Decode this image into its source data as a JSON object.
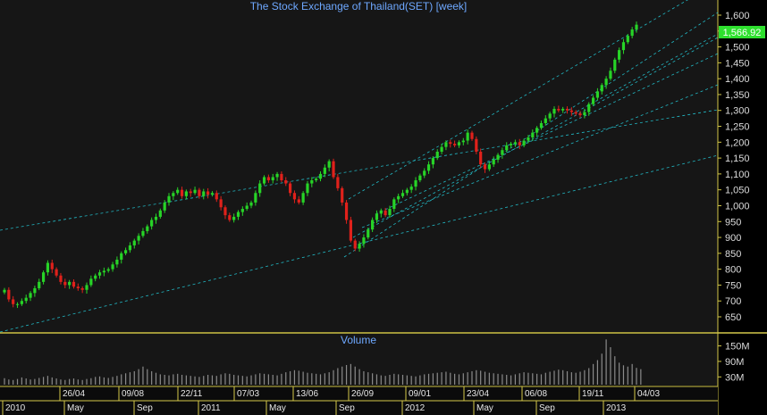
{
  "chart_data": {
    "type": "candlestick",
    "title": "The Stock Exchange of Thailand(SET) [week]",
    "volume_title": "Volume",
    "price_ylim": [
      625,
      1625
    ],
    "price_ticks": [
      "1,600",
      "1,550",
      "1,500",
      "1,450",
      "1,400",
      "1,350",
      "1,300",
      "1,250",
      "1,200",
      "1,150",
      "1,100",
      "1,050",
      "1,000",
      "950",
      "900",
      "850",
      "800",
      "750",
      "700",
      "650"
    ],
    "last_price_label": "1,566.92",
    "volume_ylim": [
      0,
      190
    ],
    "volume_ticks": [
      "150M",
      "90M",
      "30M"
    ],
    "x_week_labels": [
      "26/04",
      "09/08",
      "22/11",
      "07/03",
      "13/06",
      "26/09",
      "09/01",
      "23/04",
      "06/08",
      "19/11",
      "04/03"
    ],
    "x_month_labels": [
      "2010",
      "May",
      "Sep",
      "2011",
      "May",
      "Sep",
      "2012",
      "May",
      "Sep",
      "2013"
    ],
    "up_color": "#27d427",
    "down_color": "#e0211b",
    "trendline_color": "#22b8c4",
    "grid": false,
    "closes": [
      735,
      705,
      690,
      690,
      700,
      710,
      725,
      740,
      760,
      790,
      820,
      800,
      780,
      760,
      750,
      760,
      745,
      740,
      735,
      750,
      770,
      780,
      790,
      795,
      800,
      815,
      830,
      850,
      860,
      875,
      890,
      905,
      920,
      935,
      955,
      965,
      985,
      1010,
      1030,
      1040,
      1050,
      1030,
      1045,
      1040,
      1050,
      1030,
      1045,
      1035,
      1040,
      1020,
      995,
      970,
      955,
      965,
      980,
      990,
      1000,
      1010,
      1040,
      1070,
      1090,
      1080,
      1090,
      1100,
      1080,
      1070,
      1040,
      1020,
      1010,
      1040,
      1070,
      1080,
      1085,
      1100,
      1120,
      1140,
      1090,
      1055,
      1010,
      955,
      890,
      865,
      880,
      900,
      925,
      955,
      975,
      985,
      970,
      990,
      1020,
      1030,
      1040,
      1050,
      1060,
      1080,
      1095,
      1110,
      1130,
      1150,
      1170,
      1185,
      1200,
      1195,
      1190,
      1200,
      1205,
      1230,
      1210,
      1170,
      1130,
      1115,
      1130,
      1145,
      1160,
      1175,
      1190,
      1195,
      1200,
      1190,
      1205,
      1215,
      1230,
      1245,
      1260,
      1275,
      1290,
      1305,
      1300,
      1305,
      1300,
      1295,
      1290,
      1285,
      1295,
      1320,
      1340,
      1360,
      1380,
      1400,
      1425,
      1460,
      1490,
      1515,
      1535,
      1555,
      1570
    ],
    "volumes": [
      25,
      20,
      18,
      22,
      28,
      24,
      20,
      22,
      26,
      30,
      34,
      28,
      24,
      20,
      18,
      22,
      24,
      20,
      18,
      22,
      25,
      30,
      32,
      28,
      26,
      30,
      34,
      40,
      44,
      48,
      52,
      60,
      70,
      60,
      52,
      46,
      40,
      38,
      36,
      40,
      42,
      38,
      36,
      34,
      32,
      30,
      34,
      38,
      36,
      34,
      40,
      44,
      42,
      38,
      36,
      34,
      32,
      36,
      40,
      44,
      42,
      40,
      38,
      36,
      42,
      48,
      52,
      56,
      54,
      50,
      46,
      44,
      42,
      40,
      44,
      48,
      56,
      64,
      70,
      76,
      80,
      70,
      60,
      52,
      48,
      44,
      40,
      36,
      34,
      38,
      42,
      40,
      38,
      36,
      34,
      32,
      36,
      40,
      42,
      44,
      46,
      48,
      50,
      46,
      42,
      40,
      44,
      48,
      52,
      56,
      54,
      50,
      46,
      44,
      42,
      40,
      38,
      36,
      40,
      44,
      48,
      46,
      44,
      42,
      40,
      46,
      50,
      54,
      58,
      56,
      52,
      48,
      46,
      50,
      56,
      64,
      80,
      95,
      120,
      175,
      145,
      110,
      85,
      75,
      70,
      80,
      65,
      60
    ]
  }
}
